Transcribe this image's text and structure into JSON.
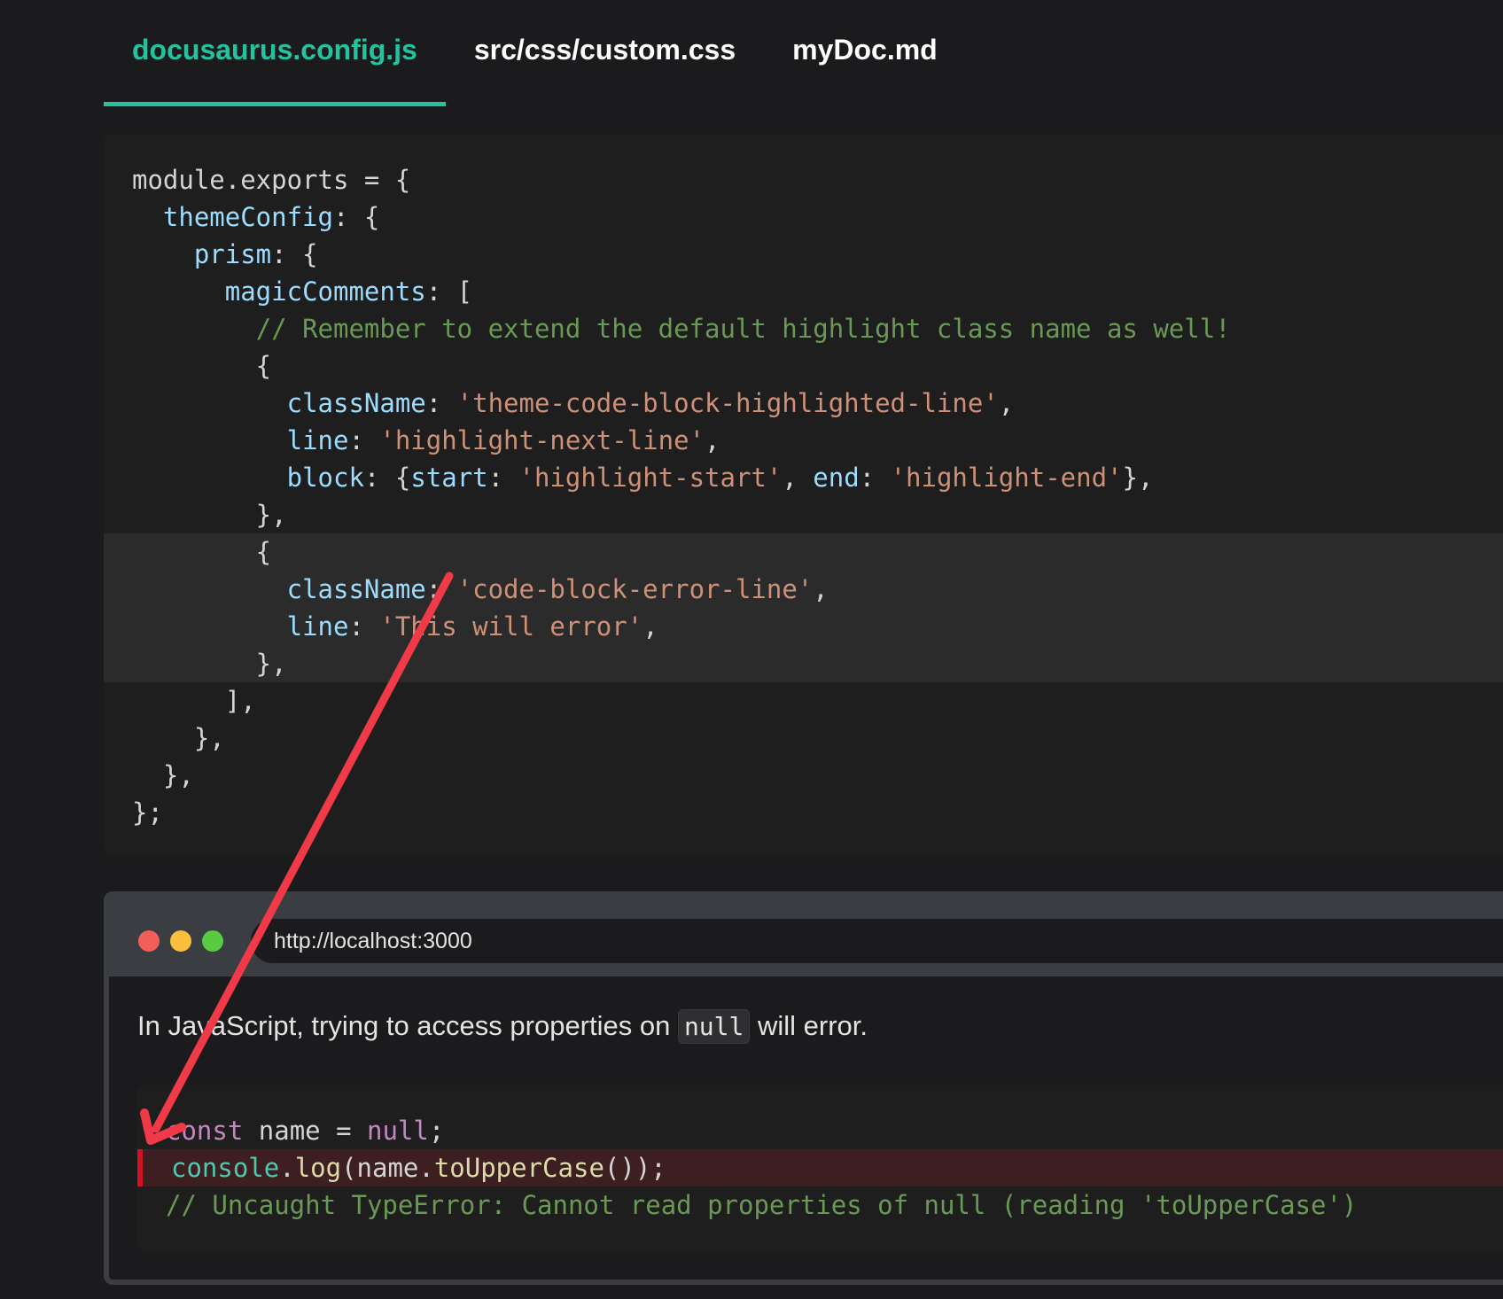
{
  "tabs": [
    {
      "label": "docusaurus.config.js",
      "active": true
    },
    {
      "label": "src/css/custom.css",
      "active": false
    },
    {
      "label": "myDoc.md",
      "active": false
    }
  ],
  "config_code": {
    "lines": [
      {
        "highlight": false,
        "tokens": [
          {
            "t": "plain",
            "v": "module.exports = {"
          }
        ]
      },
      {
        "highlight": false,
        "tokens": [
          {
            "t": "plain",
            "v": "  "
          },
          {
            "t": "prop",
            "v": "themeConfig"
          },
          {
            "t": "plain",
            "v": ": {"
          }
        ]
      },
      {
        "highlight": false,
        "tokens": [
          {
            "t": "plain",
            "v": "    "
          },
          {
            "t": "prop",
            "v": "prism"
          },
          {
            "t": "plain",
            "v": ": {"
          }
        ]
      },
      {
        "highlight": false,
        "tokens": [
          {
            "t": "plain",
            "v": "      "
          },
          {
            "t": "prop",
            "v": "magicComments"
          },
          {
            "t": "plain",
            "v": ": ["
          }
        ]
      },
      {
        "highlight": false,
        "tokens": [
          {
            "t": "plain",
            "v": "        "
          },
          {
            "t": "comment",
            "v": "// Remember to extend the default highlight class name as well!"
          }
        ]
      },
      {
        "highlight": false,
        "tokens": [
          {
            "t": "plain",
            "v": "        {"
          }
        ]
      },
      {
        "highlight": false,
        "tokens": [
          {
            "t": "plain",
            "v": "          "
          },
          {
            "t": "prop",
            "v": "className"
          },
          {
            "t": "plain",
            "v": ": "
          },
          {
            "t": "str",
            "v": "'theme-code-block-highlighted-line'"
          },
          {
            "t": "plain",
            "v": ","
          }
        ]
      },
      {
        "highlight": false,
        "tokens": [
          {
            "t": "plain",
            "v": "          "
          },
          {
            "t": "prop",
            "v": "line"
          },
          {
            "t": "plain",
            "v": ": "
          },
          {
            "t": "str",
            "v": "'highlight-next-line'"
          },
          {
            "t": "plain",
            "v": ","
          }
        ]
      },
      {
        "highlight": false,
        "tokens": [
          {
            "t": "plain",
            "v": "          "
          },
          {
            "t": "prop",
            "v": "block"
          },
          {
            "t": "plain",
            "v": ": {"
          },
          {
            "t": "prop",
            "v": "start"
          },
          {
            "t": "plain",
            "v": ": "
          },
          {
            "t": "str",
            "v": "'highlight-start'"
          },
          {
            "t": "plain",
            "v": ", "
          },
          {
            "t": "prop",
            "v": "end"
          },
          {
            "t": "plain",
            "v": ": "
          },
          {
            "t": "str",
            "v": "'highlight-end'"
          },
          {
            "t": "plain",
            "v": "},"
          }
        ]
      },
      {
        "highlight": false,
        "tokens": [
          {
            "t": "plain",
            "v": "        },"
          }
        ]
      },
      {
        "highlight": true,
        "tokens": [
          {
            "t": "plain",
            "v": "        {"
          }
        ]
      },
      {
        "highlight": true,
        "tokens": [
          {
            "t": "plain",
            "v": "          "
          },
          {
            "t": "prop",
            "v": "className"
          },
          {
            "t": "plain",
            "v": ": "
          },
          {
            "t": "str",
            "v": "'code-block-error-line'"
          },
          {
            "t": "plain",
            "v": ","
          }
        ]
      },
      {
        "highlight": true,
        "tokens": [
          {
            "t": "plain",
            "v": "          "
          },
          {
            "t": "prop",
            "v": "line"
          },
          {
            "t": "plain",
            "v": ": "
          },
          {
            "t": "str",
            "v": "'This will error'"
          },
          {
            "t": "plain",
            "v": ","
          }
        ]
      },
      {
        "highlight": true,
        "tokens": [
          {
            "t": "plain",
            "v": "        },"
          }
        ]
      },
      {
        "highlight": false,
        "tokens": [
          {
            "t": "plain",
            "v": "      ],"
          }
        ]
      },
      {
        "highlight": false,
        "tokens": [
          {
            "t": "plain",
            "v": "    },"
          }
        ]
      },
      {
        "highlight": false,
        "tokens": [
          {
            "t": "plain",
            "v": "  },"
          }
        ]
      },
      {
        "highlight": false,
        "tokens": [
          {
            "t": "plain",
            "v": "};"
          }
        ]
      }
    ]
  },
  "browser": {
    "url": "http://localhost:3000",
    "paragraph": {
      "before": "In JavaScript, trying to access properties on ",
      "code": "null",
      "after": " will error."
    },
    "demo_code": {
      "lines": [
        {
          "error": false,
          "tokens": [
            {
              "t": "kw",
              "v": "const"
            },
            {
              "t": "plain",
              "v": " name = "
            },
            {
              "t": "kw",
              "v": "null"
            },
            {
              "t": "plain",
              "v": ";"
            }
          ]
        },
        {
          "error": true,
          "tokens": [
            {
              "t": "obj",
              "v": "console"
            },
            {
              "t": "plain",
              "v": "."
            },
            {
              "t": "fn",
              "v": "log"
            },
            {
              "t": "plain",
              "v": "(name."
            },
            {
              "t": "fn",
              "v": "toUpperCase"
            },
            {
              "t": "plain",
              "v": "());"
            }
          ]
        },
        {
          "error": false,
          "tokens": [
            {
              "t": "comment",
              "v": "// Uncaught TypeError: Cannot read properties of null (reading 'toUpperCase')"
            }
          ]
        }
      ]
    }
  },
  "colors": {
    "accent": "#25c2a0",
    "arrow": "#f03a47",
    "error_line_bg": "#3d1e21",
    "error_line_border": "#cf1322"
  }
}
